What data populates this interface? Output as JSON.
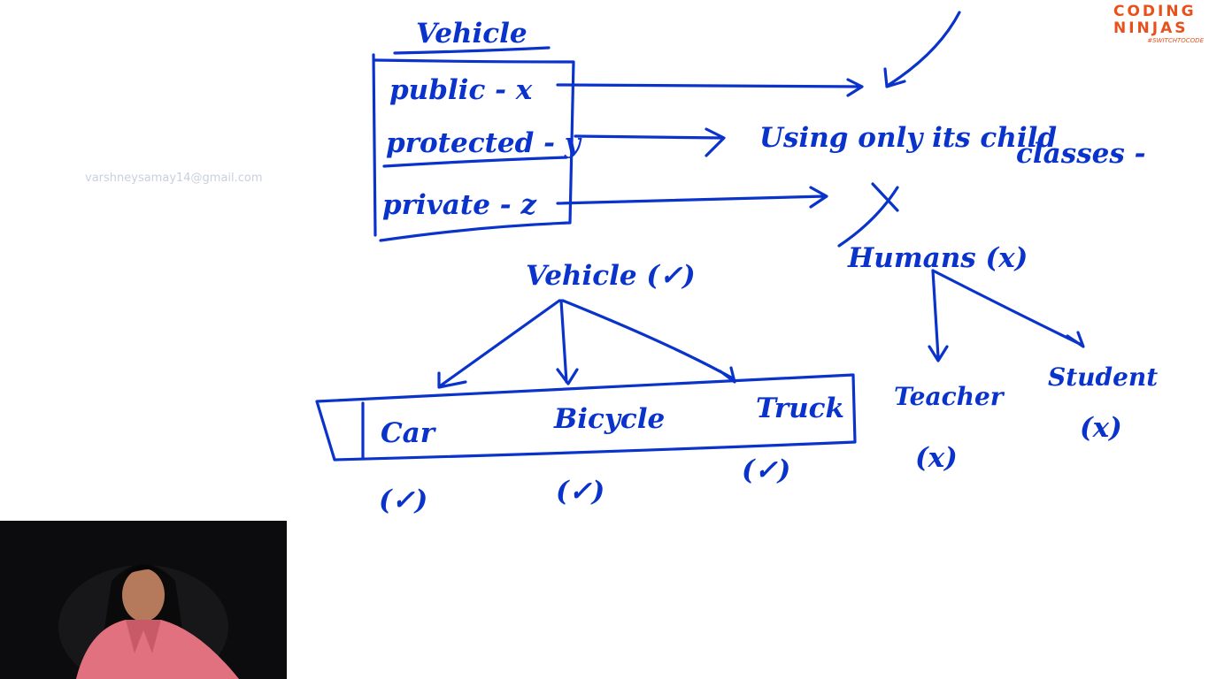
{
  "watermark": "varshneysamay14@gmail.com",
  "logo": {
    "name": "CODING NINJAS",
    "tagline": "#SWITCHTOCODE",
    "color": "#e8511c"
  },
  "ink_color": "#0a33cc",
  "board": {
    "box_title": "Vehicle",
    "members": [
      {
        "label": "public - x"
      },
      {
        "label": "protected - y"
      },
      {
        "label": "private - z"
      }
    ],
    "access_note": "Using only its child classes -",
    "tree_vehicle": {
      "root": "Vehicle (✓)",
      "children": [
        "Car",
        "Bicycle",
        "Truck"
      ],
      "marks": [
        "(✓)",
        "(✓)",
        "(✓)"
      ]
    },
    "tree_humans": {
      "root": "Humans (x)",
      "children": [
        "Teacher",
        "Student"
      ],
      "marks": [
        "(x)",
        "(x)"
      ]
    }
  }
}
